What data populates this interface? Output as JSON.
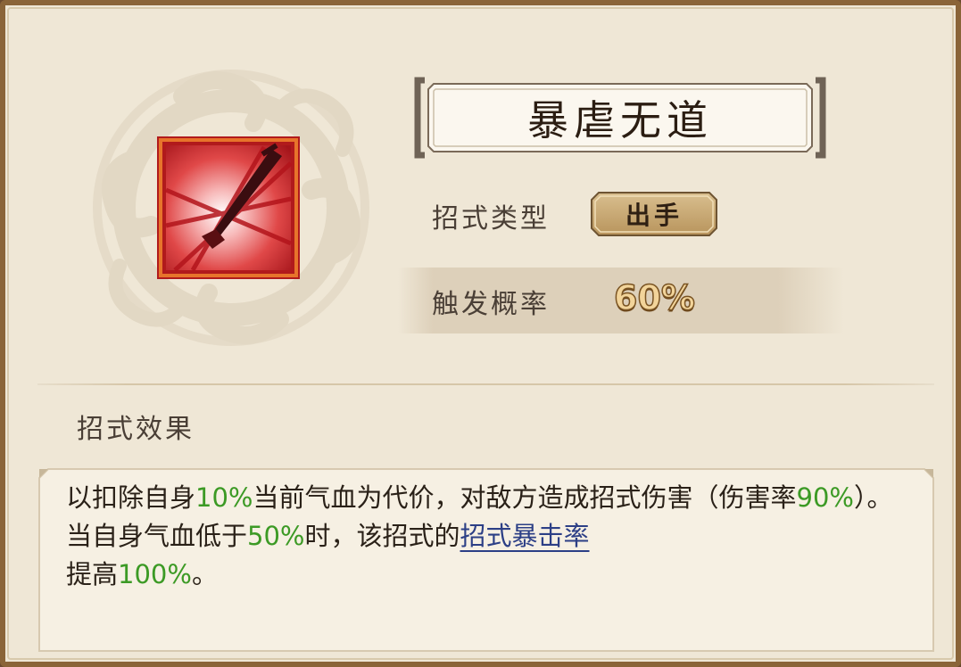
{
  "skill": {
    "name": "暴虐无道",
    "type_label": "招式类型",
    "type_value": "出手",
    "trigger_rate_label": "触发概率",
    "trigger_rate": "60%"
  },
  "effect": {
    "heading": "招式效果",
    "segments": [
      {
        "text": "以扣除自身"
      },
      {
        "text": "10%"
      },
      {
        "text": "当前气血为代价，对敌方造成招式伤害（伤害率"
      },
      {
        "text": "90%"
      },
      {
        "text": "）。当自身气血低于"
      },
      {
        "text": "50%"
      },
      {
        "text": "时，该招式的"
      },
      {
        "text": "招式暴击率"
      },
      {
        "text": "提高"
      },
      {
        "text": "100%"
      },
      {
        "text": "。"
      }
    ]
  },
  "colors": {
    "highlight_green": "#3c9a25",
    "link_blue": "#2c3f86",
    "panel_bg": "#efe7d6",
    "frame": "#8a6438"
  },
  "icons": {
    "emblem": "cloud-swirl-emblem-icon",
    "skill": "blade-slash-skill-icon"
  }
}
